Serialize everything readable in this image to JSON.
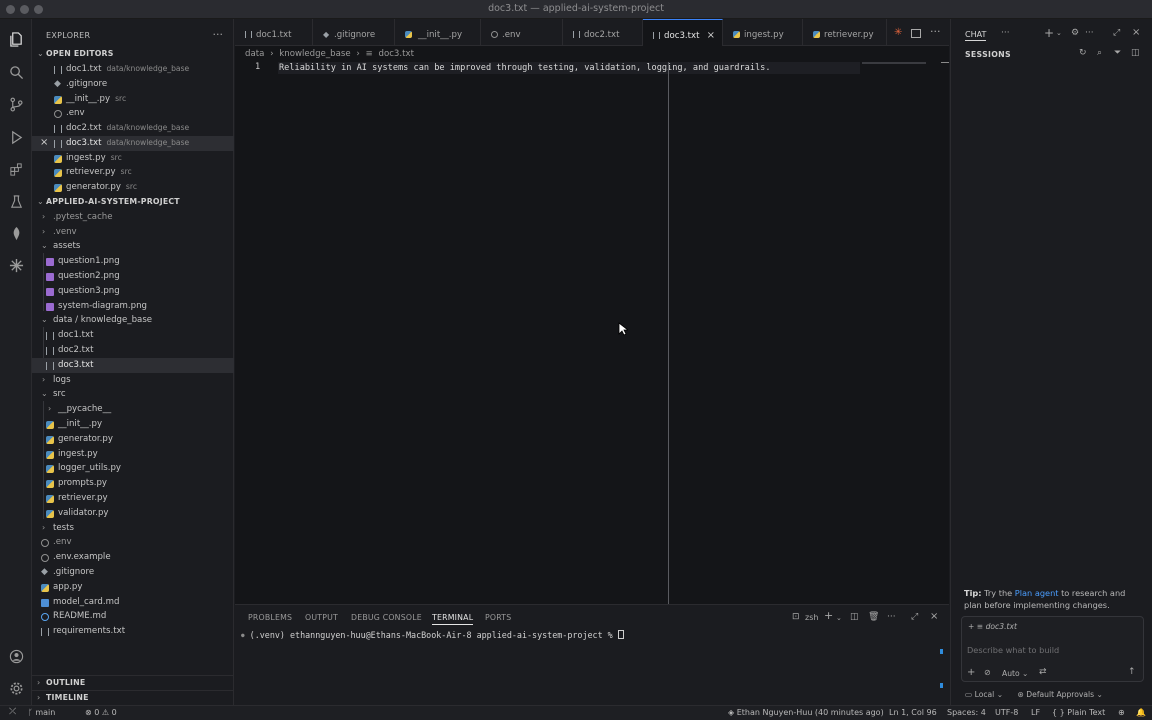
{
  "window": {
    "title": "doc3.txt — applied-ai-system-project"
  },
  "explorer": {
    "header": "EXPLORER",
    "open_editors_label": "OPEN EDITORS",
    "open_editors": [
      {
        "name": "doc1.txt",
        "desc": "data/knowledge_base"
      },
      {
        "name": ".gitignore",
        "desc": ""
      },
      {
        "name": "__init__.py",
        "desc": "src"
      },
      {
        "name": ".env",
        "desc": ""
      },
      {
        "name": "doc2.txt",
        "desc": "data/knowledge_base"
      },
      {
        "name": "doc3.txt",
        "desc": "data/knowledge_base"
      },
      {
        "name": "ingest.py",
        "desc": "src"
      },
      {
        "name": "retriever.py",
        "desc": "src"
      },
      {
        "name": "generator.py",
        "desc": "src"
      }
    ],
    "project_label": "APPLIED-AI-SYSTEM-PROJECT",
    "tree": [
      {
        "name": ".pytest_cache"
      },
      {
        "name": ".venv"
      },
      {
        "name": "assets"
      },
      {
        "name": "question1.png"
      },
      {
        "name": "question2.png"
      },
      {
        "name": "question3.png"
      },
      {
        "name": "system-diagram.png"
      },
      {
        "name": "data / knowledge_base"
      },
      {
        "name": "doc1.txt"
      },
      {
        "name": "doc2.txt"
      },
      {
        "name": "doc3.txt"
      },
      {
        "name": "logs"
      },
      {
        "name": "src"
      },
      {
        "name": "__pycache__"
      },
      {
        "name": "__init__.py"
      },
      {
        "name": "generator.py"
      },
      {
        "name": "ingest.py"
      },
      {
        "name": "logger_utils.py"
      },
      {
        "name": "prompts.py"
      },
      {
        "name": "retriever.py"
      },
      {
        "name": "validator.py"
      },
      {
        "name": "tests"
      },
      {
        "name": ".env"
      },
      {
        "name": ".env.example"
      },
      {
        "name": ".gitignore"
      },
      {
        "name": "app.py"
      },
      {
        "name": "model_card.md"
      },
      {
        "name": "README.md"
      },
      {
        "name": "requirements.txt"
      }
    ],
    "outline_label": "OUTLINE",
    "timeline_label": "TIMELINE"
  },
  "tabs": [
    {
      "label": "doc1.txt"
    },
    {
      "label": ".gitignore"
    },
    {
      "label": "__init__.py"
    },
    {
      "label": ".env"
    },
    {
      "label": "doc2.txt"
    },
    {
      "label": "doc3.txt"
    },
    {
      "label": "ingest.py"
    },
    {
      "label": "retriever.py"
    }
  ],
  "editor": {
    "breadcrumb": [
      "data",
      "knowledge_base",
      "doc3.txt"
    ],
    "line_number": "1",
    "line_text": "Reliability in AI systems can be improved through testing, validation, logging, and guardrails."
  },
  "panel": {
    "tabs": [
      "PROBLEMS",
      "OUTPUT",
      "DEBUG CONSOLE",
      "TERMINAL",
      "PORTS"
    ],
    "shell": "zsh",
    "prompt": "(.venv) ethannguyen-huu@Ethans-MacBook-Air-8 applied-ai-system-project % "
  },
  "chat": {
    "title": "CHAT",
    "sessions_label": "SESSIONS",
    "tip_bold": "Tip:",
    "tip_pre": " Try the ",
    "tip_link": "Plan agent",
    "tip_post": " to research and plan before implementing changes.",
    "context_file": "doc3.txt",
    "input_placeholder": "Describe what to build",
    "mode": "Auto",
    "location": "Local",
    "approvals": "Default Approvals"
  },
  "status": {
    "branch": "main",
    "errors": "0",
    "warnings": "0",
    "blame": "Ethan Nguyen-Huu (40 minutes ago)",
    "position": "Ln 1, Col 96",
    "spaces": "Spaces: 4",
    "encoding": "UTF-8",
    "eol": "LF",
    "language": "Plain Text"
  }
}
